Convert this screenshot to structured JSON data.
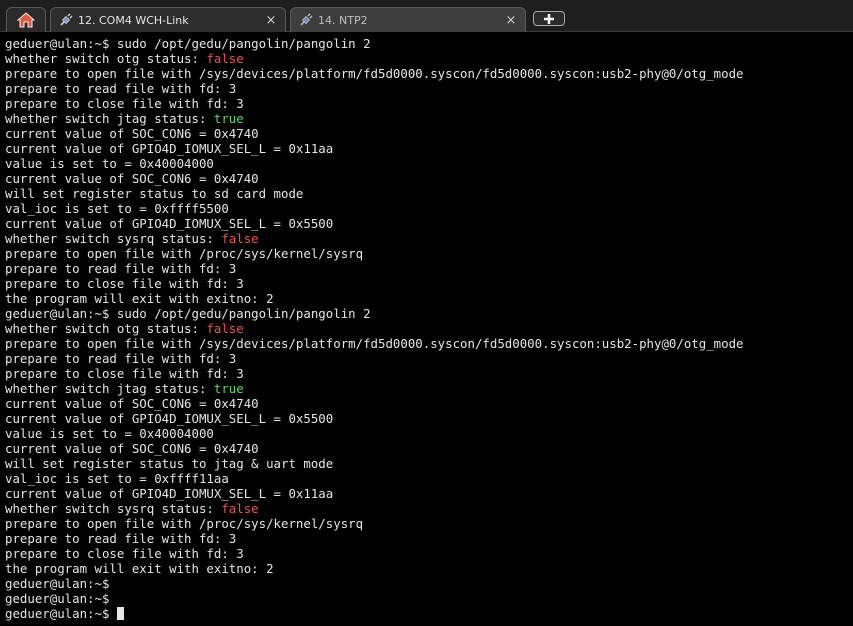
{
  "tabs": {
    "home_icon": "home-icon",
    "active": {
      "label": "12. COM4  WCH-Link",
      "icon": "plug-icon",
      "close": "×"
    },
    "inactive": {
      "label": "14. NTP2",
      "icon": "plug-icon",
      "close": "×"
    },
    "new_tab_icon": "plus-icon"
  },
  "colors": {
    "false_value": "#ef5350",
    "true_value": "#5fd76b",
    "text": "#e5e5e5",
    "background": "#000000"
  },
  "terminal": {
    "lines": [
      {
        "text": "geduer@ulan:~$ sudo /opt/gedu/pangolin/pangolin 2"
      },
      {
        "text": "whether switch otg status: ",
        "value": "false",
        "kind": "false"
      },
      {
        "text": "prepare to open file with /sys/devices/platform/fd5d0000.syscon/fd5d0000.syscon:usb2-phy@0/otg_mode"
      },
      {
        "text": "prepare to read file with fd: 3"
      },
      {
        "text": "prepare to close file with fd: 3"
      },
      {
        "text": "whether switch jtag status: ",
        "value": "true",
        "kind": "true"
      },
      {
        "text": "current value of SOC_CON6 = 0x4740"
      },
      {
        "text": "current value of GPIO4D_IOMUX_SEL_L = 0x11aa"
      },
      {
        "text": "value is set to = 0x40004000"
      },
      {
        "text": "current value of SOC_CON6 = 0x4740"
      },
      {
        "text": "will set register status to sd card mode"
      },
      {
        "text": "val_ioc is set to = 0xffff5500"
      },
      {
        "text": "current value of GPIO4D_IOMUX_SEL_L = 0x5500"
      },
      {
        "text": "whether switch sysrq status: ",
        "value": "false",
        "kind": "false"
      },
      {
        "text": "prepare to open file with /proc/sys/kernel/sysrq"
      },
      {
        "text": "prepare to read file with fd: 3"
      },
      {
        "text": "prepare to close file with fd: 3"
      },
      {
        "text": "the program will exit with exitno: 2"
      },
      {
        "text": "geduer@ulan:~$ sudo /opt/gedu/pangolin/pangolin 2"
      },
      {
        "text": "whether switch otg status: ",
        "value": "false",
        "kind": "false"
      },
      {
        "text": "prepare to open file with /sys/devices/platform/fd5d0000.syscon/fd5d0000.syscon:usb2-phy@0/otg_mode"
      },
      {
        "text": "prepare to read file with fd: 3"
      },
      {
        "text": "prepare to close file with fd: 3"
      },
      {
        "text": "whether switch jtag status: ",
        "value": "true",
        "kind": "true"
      },
      {
        "text": "current value of SOC_CON6 = 0x4740"
      },
      {
        "text": "current value of GPIO4D_IOMUX_SEL_L = 0x5500"
      },
      {
        "text": "value is set to = 0x40004000"
      },
      {
        "text": "current value of SOC_CON6 = 0x4740"
      },
      {
        "text": "will set register status to jtag & uart mode"
      },
      {
        "text": "val_ioc is set to = 0xffff11aa"
      },
      {
        "text": "current value of GPIO4D_IOMUX_SEL_L = 0x11aa"
      },
      {
        "text": "whether switch sysrq status: ",
        "value": "false",
        "kind": "false"
      },
      {
        "text": "prepare to open file with /proc/sys/kernel/sysrq"
      },
      {
        "text": "prepare to read file with fd: 3"
      },
      {
        "text": "prepare to close file with fd: 3"
      },
      {
        "text": "the program will exit with exitno: 2"
      },
      {
        "text": "geduer@ulan:~$"
      },
      {
        "text": "geduer@ulan:~$"
      },
      {
        "text": "geduer@ulan:~$ ",
        "cursor": true
      }
    ]
  }
}
